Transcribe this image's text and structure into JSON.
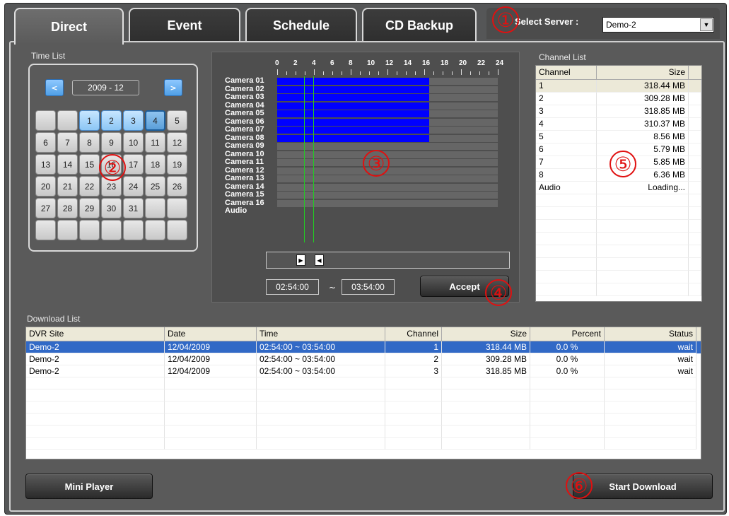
{
  "tabs": [
    {
      "label": "Direct",
      "active": true
    },
    {
      "label": "Event",
      "active": false
    },
    {
      "label": "Schedule",
      "active": false
    },
    {
      "label": "CD Backup",
      "active": false
    }
  ],
  "server": {
    "label": "Select Server :",
    "value": "Demo-2"
  },
  "time_list": {
    "label": "Time List",
    "prev_label": "<",
    "next_label": ">",
    "month": "2009 - 12",
    "days": [
      {
        "d": "",
        "s": ""
      },
      {
        "d": "",
        "s": ""
      },
      {
        "d": "1",
        "s": "rec"
      },
      {
        "d": "2",
        "s": "rec"
      },
      {
        "d": "3",
        "s": "rec"
      },
      {
        "d": "4",
        "s": "sel"
      },
      {
        "d": "5",
        "s": ""
      },
      {
        "d": "6",
        "s": ""
      },
      {
        "d": "7",
        "s": ""
      },
      {
        "d": "8",
        "s": ""
      },
      {
        "d": "9",
        "s": ""
      },
      {
        "d": "10",
        "s": ""
      },
      {
        "d": "11",
        "s": ""
      },
      {
        "d": "12",
        "s": ""
      },
      {
        "d": "13",
        "s": ""
      },
      {
        "d": "14",
        "s": ""
      },
      {
        "d": "15",
        "s": ""
      },
      {
        "d": "16",
        "s": ""
      },
      {
        "d": "17",
        "s": ""
      },
      {
        "d": "18",
        "s": ""
      },
      {
        "d": "19",
        "s": ""
      },
      {
        "d": "20",
        "s": ""
      },
      {
        "d": "21",
        "s": ""
      },
      {
        "d": "22",
        "s": ""
      },
      {
        "d": "23",
        "s": ""
      },
      {
        "d": "24",
        "s": ""
      },
      {
        "d": "25",
        "s": ""
      },
      {
        "d": "26",
        "s": ""
      },
      {
        "d": "27",
        "s": ""
      },
      {
        "d": "28",
        "s": ""
      },
      {
        "d": "29",
        "s": ""
      },
      {
        "d": "30",
        "s": ""
      },
      {
        "d": "31",
        "s": ""
      },
      {
        "d": "",
        "s": ""
      },
      {
        "d": "",
        "s": ""
      },
      {
        "d": "",
        "s": ""
      },
      {
        "d": "",
        "s": ""
      },
      {
        "d": "",
        "s": ""
      },
      {
        "d": "",
        "s": ""
      },
      {
        "d": "",
        "s": ""
      },
      {
        "d": "",
        "s": ""
      },
      {
        "d": "",
        "s": ""
      }
    ]
  },
  "timeline": {
    "hours": [
      "0",
      "2",
      "4",
      "6",
      "8",
      "10",
      "12",
      "14",
      "16",
      "18",
      "20",
      "22",
      "24"
    ],
    "cameras": [
      {
        "name": "Camera 01",
        "rec_end_hour": 16.5
      },
      {
        "name": "Camera 02",
        "rec_end_hour": 16.5
      },
      {
        "name": "Camera 03",
        "rec_end_hour": 16.5
      },
      {
        "name": "Camera 04",
        "rec_end_hour": 16.5
      },
      {
        "name": "Camera 05",
        "rec_end_hour": 16.5
      },
      {
        "name": "Camera 06",
        "rec_end_hour": 16.5
      },
      {
        "name": "Camera 07",
        "rec_end_hour": 16.5
      },
      {
        "name": "Camera 08",
        "rec_end_hour": 16.5
      },
      {
        "name": "Camera 09",
        "rec_end_hour": 0
      },
      {
        "name": "Camera 10",
        "rec_end_hour": 0
      },
      {
        "name": "Camera 11",
        "rec_end_hour": 0
      },
      {
        "name": "Camera 12",
        "rec_end_hour": 0
      },
      {
        "name": "Camera 13",
        "rec_end_hour": 0
      },
      {
        "name": "Camera 14",
        "rec_end_hour": 0
      },
      {
        "name": "Camera 15",
        "rec_end_hour": 0
      },
      {
        "name": "Camera 16",
        "rec_end_hour": 0
      }
    ],
    "audio_label": "Audio",
    "selection_start_hour": 2.9,
    "selection_end_hour": 3.9,
    "start_time": "02:54:00",
    "tilde": "~",
    "end_time": "03:54:00",
    "accept_label": "Accept"
  },
  "channel_list": {
    "label": "Channel List",
    "headers": [
      "Channel",
      "Size"
    ],
    "rows": [
      {
        "channel": "1",
        "size": "318.44 MB"
      },
      {
        "channel": "2",
        "size": "309.28 MB"
      },
      {
        "channel": "3",
        "size": "318.85 MB"
      },
      {
        "channel": "4",
        "size": "310.37 MB"
      },
      {
        "channel": "5",
        "size": "8.56 MB"
      },
      {
        "channel": "6",
        "size": "5.79 MB"
      },
      {
        "channel": "7",
        "size": "5.85 MB"
      },
      {
        "channel": "8",
        "size": "6.36 MB"
      },
      {
        "channel": "Audio",
        "size": "Loading..."
      }
    ]
  },
  "download_list": {
    "label": "Download List",
    "headers": [
      "DVR Site",
      "Date",
      "Time",
      "Channel",
      "Size",
      "Percent",
      "Status"
    ],
    "rows": [
      {
        "site": "Demo-2",
        "date": "12/04/2009",
        "time": "02:54:00 ~ 03:54:00",
        "channel": "1",
        "size": "318.44 MB",
        "percent": "0.0 %",
        "status": "wait"
      },
      {
        "site": "Demo-2",
        "date": "12/04/2009",
        "time": "02:54:00 ~ 03:54:00",
        "channel": "2",
        "size": "309.28 MB",
        "percent": "0.0 %",
        "status": "wait"
      },
      {
        "site": "Demo-2",
        "date": "12/04/2009",
        "time": "02:54:00 ~ 03:54:00",
        "channel": "3",
        "size": "318.85 MB",
        "percent": "0.0 %",
        "status": "wait"
      }
    ]
  },
  "buttons": {
    "mini_player": "Mini Player",
    "start_download": "Start Download"
  },
  "markers": [
    "①",
    "②",
    "③",
    "④",
    "⑤",
    "⑥"
  ],
  "colors": {
    "recording": "#0000ff",
    "selection_line": "#22cc22",
    "marker": "#e01010",
    "selected_row": "#3169c6"
  }
}
